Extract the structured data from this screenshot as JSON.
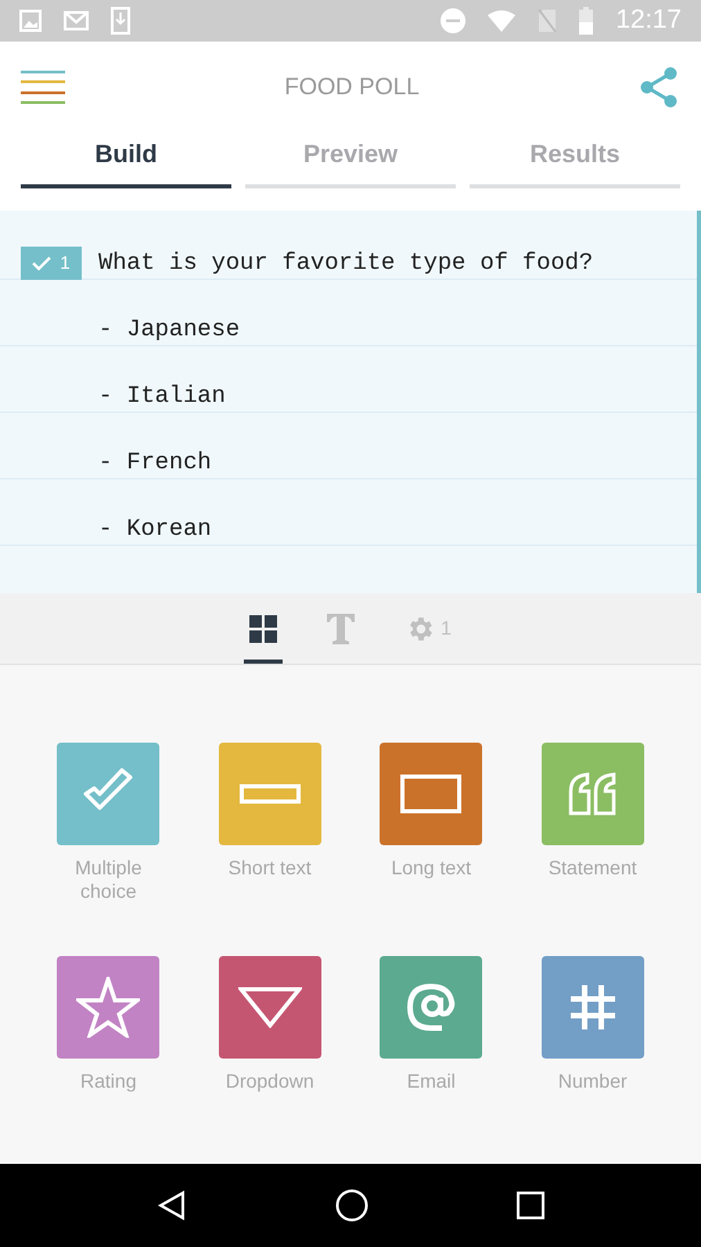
{
  "status_bar": {
    "time": "12:17"
  },
  "header": {
    "title": "FOOD POLL"
  },
  "tabs": [
    {
      "label": "Build",
      "selected": true
    },
    {
      "label": "Preview",
      "selected": false
    },
    {
      "label": "Results",
      "selected": false
    }
  ],
  "editor": {
    "badge": "1",
    "lines": [
      "What is your favorite type of food?",
      "- Japanese",
      "- Italian",
      "- French",
      "- Korean"
    ]
  },
  "toolbar": [
    {
      "kind": "blocks",
      "selected": true
    },
    {
      "kind": "text",
      "selected": false
    },
    {
      "kind": "settings",
      "selected": false,
      "count": "1"
    }
  ],
  "blocks": [
    {
      "kind": "check",
      "label": "Multiple choice",
      "color": "#74bfc9"
    },
    {
      "kind": "short",
      "label": "Short text",
      "color": "#e4b83f"
    },
    {
      "kind": "long",
      "label": "Long text",
      "color": "#cb722a"
    },
    {
      "kind": "quote",
      "label": "Statement",
      "color": "#8bbd62"
    },
    {
      "kind": "star",
      "label": "Rating",
      "color": "#c283c4"
    },
    {
      "kind": "dropdown",
      "label": "Dropdown",
      "color": "#c55672"
    },
    {
      "kind": "email",
      "label": "Email",
      "color": "#5caa8f"
    },
    {
      "kind": "number",
      "label": "Number",
      "color": "#739ec6"
    }
  ]
}
